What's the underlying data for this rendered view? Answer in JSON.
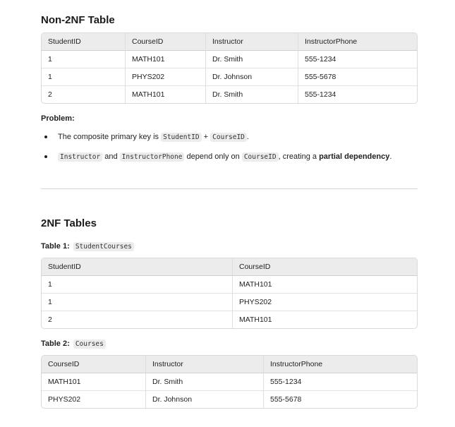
{
  "section1": {
    "title": "Non-2NF Table",
    "table": {
      "headers": [
        "StudentID",
        "CourseID",
        "Instructor",
        "InstructorPhone"
      ],
      "rows": [
        [
          "1",
          "MATH101",
          "Dr. Smith",
          "555-1234"
        ],
        [
          "1",
          "PHYS202",
          "Dr. Johnson",
          "555-5678"
        ],
        [
          "2",
          "MATH101",
          "Dr. Smith",
          "555-1234"
        ]
      ]
    },
    "problem_label": "Problem:",
    "bullet1": {
      "text_a": "The composite primary key is ",
      "code_a": "StudentID",
      "text_b": " + ",
      "code_b": "CourseID",
      "text_c": "."
    },
    "bullet2": {
      "code_a": "Instructor",
      "text_a": " and ",
      "code_b": "InstructorPhone",
      "text_b": " depend only on ",
      "code_c": "CourseID",
      "text_c": ", creating a ",
      "bold": "partial dependency",
      "text_d": "."
    }
  },
  "section2": {
    "title": "2NF Tables",
    "table1": {
      "label": "Table 1:",
      "code": "StudentCourses",
      "headers": [
        "StudentID",
        "CourseID"
      ],
      "rows": [
        [
          "1",
          "MATH101"
        ],
        [
          "1",
          "PHYS202"
        ],
        [
          "2",
          "MATH101"
        ]
      ]
    },
    "table2": {
      "label": "Table 2:",
      "code": "Courses",
      "headers": [
        "CourseID",
        "Instructor",
        "InstructorPhone"
      ],
      "rows": [
        [
          "MATH101",
          "Dr. Smith",
          "555-1234"
        ],
        [
          "PHYS202",
          "Dr. Johnson",
          "555-5678"
        ]
      ]
    }
  }
}
